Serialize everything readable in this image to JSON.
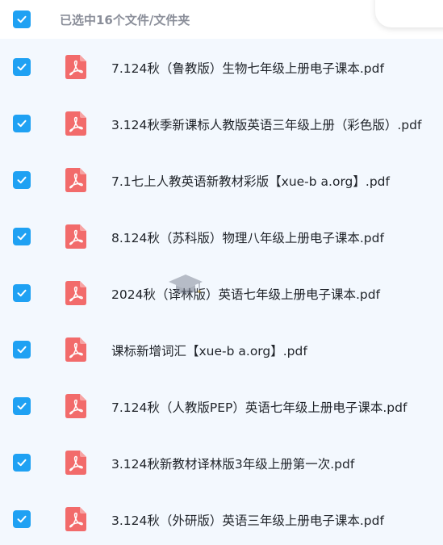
{
  "header": {
    "title": "已选中16个文件/文件夹",
    "select_all_checked": true
  },
  "files": [
    {
      "name": "7.124秋（鲁教版）生物七年级上册电子课本.pdf",
      "checked": true,
      "icon": "pdf-icon"
    },
    {
      "name": "3.124秋季新课标人教版英语三年级上册（彩色版）.pdf",
      "checked": true,
      "icon": "pdf-icon"
    },
    {
      "name": "7.1七上人教英语新教材彩版【xue-b a.org】.pdf",
      "checked": true,
      "icon": "pdf-icon"
    },
    {
      "name": "8.124秋（苏科版）物理八年级上册电子课本.pdf",
      "checked": true,
      "icon": "pdf-icon"
    },
    {
      "name": "2024秋（译林版）英语七年级上册电子课本.pdf",
      "checked": true,
      "icon": "pdf-icon"
    },
    {
      "name": "课标新增词汇【xue-b a.org】.pdf",
      "checked": true,
      "icon": "pdf-icon"
    },
    {
      "name": "7.124秋（人教版PEP）英语七年级上册电子课本.pdf",
      "checked": true,
      "icon": "pdf-icon"
    },
    {
      "name": "3.124秋新教材译林版3年级上册第一次.pdf",
      "checked": true,
      "icon": "pdf-icon"
    },
    {
      "name": "3.124秋（外研版）英语三年级上册电子课本.pdf",
      "checked": true,
      "icon": "pdf-icon"
    }
  ],
  "colors": {
    "checkbox": "#1fa1f3",
    "pdf_icon": "#f26b6b",
    "list_bg": "#f3f8fe",
    "header_text": "#8a8e99",
    "file_text": "#1f2329"
  }
}
